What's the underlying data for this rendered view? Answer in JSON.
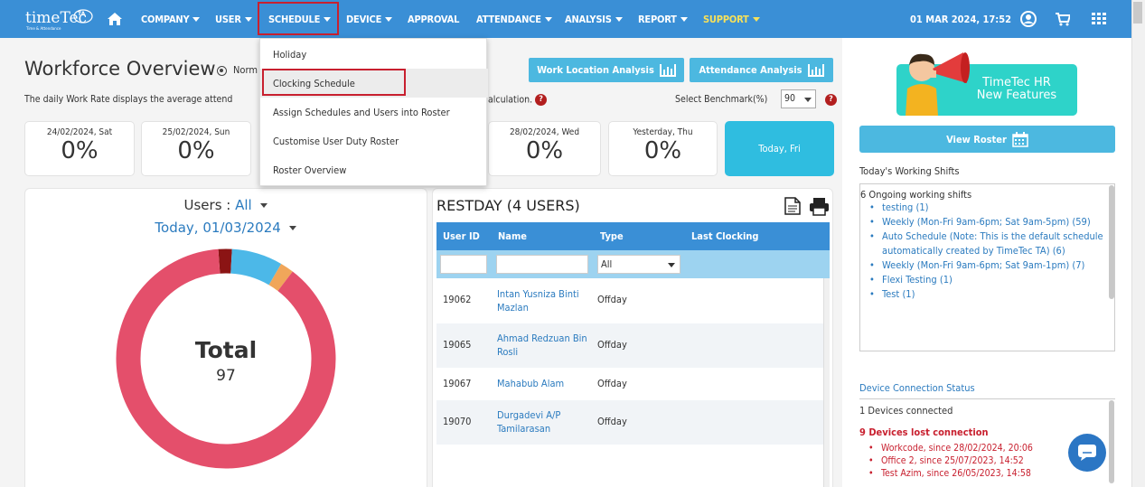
{
  "brand": {
    "logo_text": "timeTec",
    "logo_tagline": "Time & Attendance",
    "logo_badge": "TA"
  },
  "nav": {
    "items": [
      {
        "label": "COMPANY",
        "caret": true
      },
      {
        "label": "USER",
        "caret": true
      },
      {
        "label": "SCHEDULE",
        "caret": true
      },
      {
        "label": "DEVICE",
        "caret": true
      },
      {
        "label": "APPROVAL",
        "caret": false
      },
      {
        "label": "ATTENDANCE",
        "caret": true
      },
      {
        "label": "ANALYSIS",
        "caret": true
      },
      {
        "label": "REPORT",
        "caret": true
      },
      {
        "label": "SUPPORT",
        "caret": true
      }
    ],
    "datetime": "01 MAR 2024, 17:52",
    "icons": [
      "home-icon",
      "user-icon",
      "cart-icon",
      "grid-icon"
    ],
    "support_color": "#f7e15a",
    "bar_color": "#3a8fd6"
  },
  "schedule_menu": [
    "Holiday",
    "Clocking Schedule",
    "Assign Schedules and Users into Roster",
    "Customise User Duty Roster",
    "Roster Overview"
  ],
  "overview": {
    "title": "Workforce Overview",
    "mode": "Norm",
    "subtitle": "The daily Work Rate displays the average attend",
    "subtitle_tail": "alculation.",
    "btn_location": "Work Location Analysis",
    "btn_attendance": "Attendance Analysis",
    "benchmark_label": "Select Benchmark(%)",
    "benchmark_value": "90"
  },
  "days": [
    {
      "date": "24/02/2024, Sat",
      "pct": "0%"
    },
    {
      "date": "25/02/2024, Sun",
      "pct": "0%"
    },
    {
      "date": "28/02/2024, Wed",
      "pct": "0%"
    },
    {
      "date": "Yesterday, Thu",
      "pct": "0%"
    },
    {
      "date": "Today, Fri",
      "pct": ""
    }
  ],
  "users_panel": {
    "users_label": "Users",
    "users_value": "All",
    "date": "Today, 01/03/2024",
    "total_label": "Total",
    "total_value": "97",
    "donut": [
      {
        "label": "main",
        "fraction": 0.885,
        "color": "#e44f6b"
      },
      {
        "label": "dark",
        "fraction": 0.02,
        "color": "#8b1414"
      },
      {
        "label": "blue",
        "fraction": 0.075,
        "color": "#4cb8e8"
      },
      {
        "label": "orange",
        "fraction": 0.02,
        "color": "#f0a65a"
      }
    ]
  },
  "restday": {
    "title": "RESTDAY (4 USERS)",
    "columns": [
      "User ID",
      "Name",
      "Type",
      "Last Clocking"
    ],
    "type_filter": "All",
    "rows": [
      {
        "id": "19062",
        "name": "Intan Yusniza Binti Mazlan",
        "type": "Offday"
      },
      {
        "id": "19065",
        "name": "Ahmad Redzuan Bin Rosli",
        "type": "Offday"
      },
      {
        "id": "19067",
        "name": "Mahabub Alam",
        "type": "Offday"
      },
      {
        "id": "19070",
        "name": "Durgadevi A/P Tamilarasan",
        "type": "Offday"
      }
    ]
  },
  "sidebar": {
    "banner_line1": "TimeTec HR",
    "banner_line2": "New Features",
    "view_roster": "View Roster",
    "working_shifts_title": "Today's Working Shifts",
    "ongoing": "6 Ongoing working shifts",
    "shifts": [
      "testing (1)",
      "Weekly (Mon-Fri 9am-6pm; Sat 9am-5pm) (59)",
      "Auto Schedule (Note: This is the default schedule automatically created by TimeTec TA) (6)",
      "Weekly (Mon-Fri 9am-6pm; Sat 9am-1pm) (7)",
      "Flexi Testing (1)",
      "Test (1)"
    ],
    "device_status_title": "Device Connection Status",
    "connected": "1 Devices connected",
    "lost": "9 Devices lost connection",
    "lost_list": [
      "Workcode, since 28/02/2024, 20:06",
      "Office 2, since 25/07/2023, 14:52",
      "Test Azim, since 26/05/2023, 14:58"
    ]
  }
}
